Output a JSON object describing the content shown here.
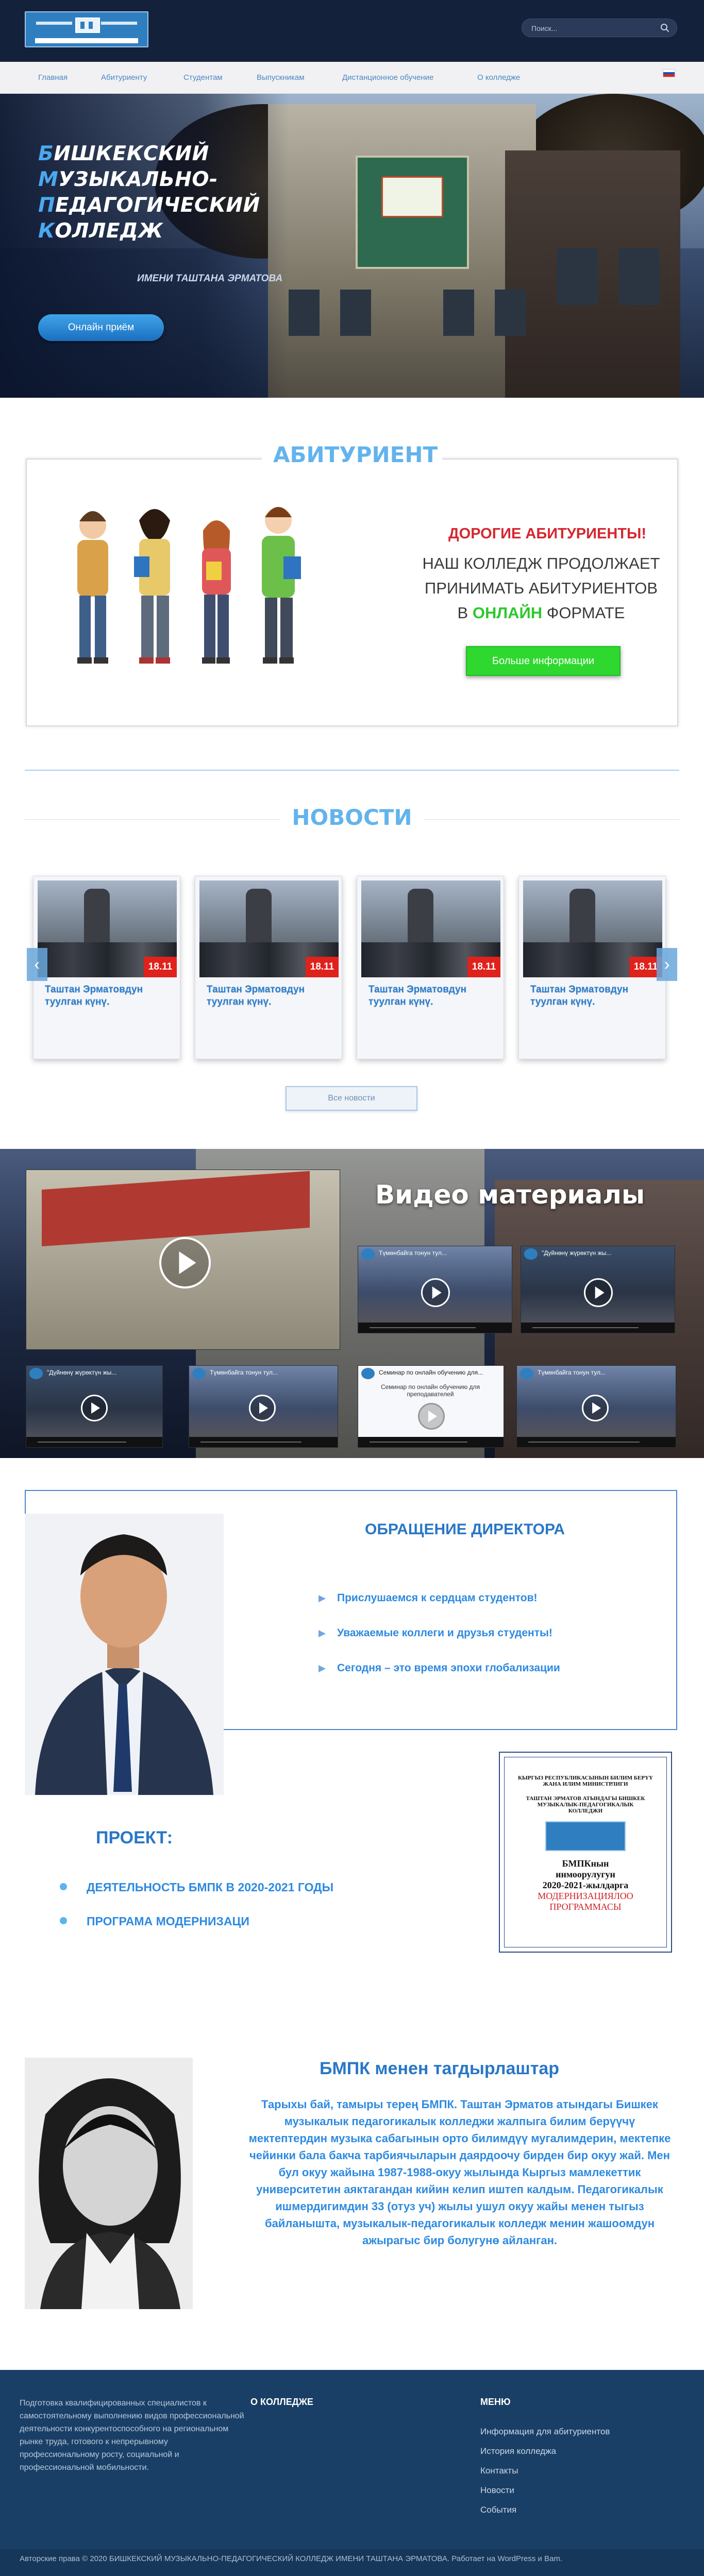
{
  "header": {
    "search_placeholder": "Поиск...",
    "nav": [
      "Главная",
      "Абитуриенту",
      "Студентам",
      "Выпускникам",
      "Дистанционное обучение",
      "О колледже"
    ]
  },
  "hero": {
    "title_lines": [
      {
        "cap": "Б",
        "rest": "ИШКЕКСКИЙ"
      },
      {
        "cap": "М",
        "rest": "УЗЫКАЛЬНО-"
      },
      {
        "cap": "П",
        "rest": "ЕДАГОГИЧЕСКИЙ"
      },
      {
        "cap": "К",
        "rest": "ОЛЛЕДЖ"
      }
    ],
    "subtitle": "ИМЕНИ ТАШТАНА ЭРМАТОВА",
    "button": "Онлайн приём"
  },
  "applicants": {
    "title": "АБИТУРИЕНТ",
    "heading": "ДОРОГИЕ АБИТУРИЕНТЫ!",
    "text_line1": "НАШ КОЛЛЕДЖ ПРОДОЛЖАЕТ",
    "text_line2": "ПРИНИМАТЬ АБИТУРИЕНТОВ",
    "text_pre": "В ",
    "text_highlight": "ОНЛАЙН",
    "text_post": " ФОРМАТЕ",
    "button": "Больше информации"
  },
  "news": {
    "title": "НОВОСТИ",
    "items": [
      {
        "date": "18.11",
        "title": "Таштан Эрматовдун туулган күнү."
      },
      {
        "date": "18.11",
        "title": "Таштан Эрматовдун туулган күнү."
      },
      {
        "date": "18.11",
        "title": "Таштан Эрматовдун туулган күнү."
      },
      {
        "date": "18.11",
        "title": "Таштан Эрматовдун туулган күнү."
      }
    ],
    "all_button": "Все новости",
    "prev": "‹",
    "next": "›"
  },
  "videos": {
    "title": "Видео материалы",
    "items": [
      {
        "title": "Түмөнбайга тонун тул..."
      },
      {
        "title": "\"Дүйнөнү жүрөктүн жы..."
      },
      {
        "title": "\"Дүйнөнү жүрөктүн жы..."
      },
      {
        "title": "Түмөнбайга тонун тул..."
      },
      {
        "title": "Семинар по онлайн обучению для..."
      },
      {
        "title": "Түмөнбайга тонун тул..."
      }
    ],
    "seminar_caption": "Семинар по онлайн обучению для преподавателей"
  },
  "director": {
    "title": "ОБРАЩЕНИЕ ДИРЕКТОРА",
    "items": [
      "Прислушаемся к  сердцам  студентов!",
      "Уважаемые коллеги и друзья студенты!",
      "Сегодня – это время эпохи  глобализации"
    ]
  },
  "document": {
    "line1": "КЫРГЫЗ РЕСПУБЛИКАСЫНЫН БИЛИМ БЕРҮҮ ЖАНА ИЛИМ МИНИСТРЛИГИ",
    "line2": "ТАШТАН ЭРМАТОВ АТЫНДАГЫ БИШКЕК МУЗЫКАЛЫК-ПЕДАГОГИКАЛЫК КОЛЛЕДЖИ",
    "line3": "БМПКнын",
    "line4": "инмоорулугун",
    "line5": "2020-2021-жылдарга",
    "line6": "МОДЕРНИЗАЦИЯЛОО",
    "line7": "ПРОГРАММАСЫ"
  },
  "project": {
    "title": "ПРОЕКТ:",
    "items": [
      "ДЕЯТЕЛЬНОСТЬ  БМПК  В  2020-2021 ГОДЫ",
      "ПРОГРАМА МОДЕРНИЗАЦИ"
    ]
  },
  "bmpk": {
    "title": "БМПК менен тагдырлаштар",
    "text": "Тарыхы бай, тамыры терең БМПК. Таштан Эрматов атындагы Бишкек музыкалык педагогикалык колледжи жалпыга билим берүүчү мектептердин музыка сабагынын орто билимдүү мугалимдерин, мектепке чейинки бала бакча тарбиячыларын даярдоочу бирден бир окуу жай. Мен бул окуу жайына 1987-1988-окуу жылында Кыргыз мамлекеттик университетин аяктагандан кийин келип иштеп калдым. Педагогикалык ишмердигимдин 33 (отуз уч) жылы ушул окуу жайы менен тыгыз байланышта, музыкалык-педагогикалык колледж менин жашоомдун ажырагыс бир болугунө айланган."
  },
  "footer": {
    "about": "Подготовка квалифицированных специалистов к самостоятельному выполнению видов профессиональной деятельности конкурентоспособного на региональном рынке труда, готового к непрерывному профессиональному росту, социальной и профессиональной мобильности.",
    "col2_title": "О КОЛЛЕДЖЕ",
    "col3_title": "МЕНЮ",
    "links": [
      "Информация для абитуриентов",
      "История колледжа",
      "Контакты",
      "Новости",
      "События"
    ],
    "copyright": "Авторские права © 2020 БИШКЕКСКИЙ МУЗЫКАЛЬНО-ПЕДАГОГИЧЕСКИЙ КОЛЛЕДЖ ИМЕНИ ТАШТАНА ЭРМАТОВА. Работает на WordPress и Bam."
  },
  "icons": [
    "logo",
    "search-icon",
    "flag-ru-icon",
    "play-icon",
    "chevron-left-icon",
    "chevron-right-icon",
    "bullet-arrow-icon"
  ],
  "colors": {
    "accent": "#2977c6",
    "light_accent": "#63b3ed",
    "danger": "#d6262f",
    "online": "#2ec72e"
  }
}
